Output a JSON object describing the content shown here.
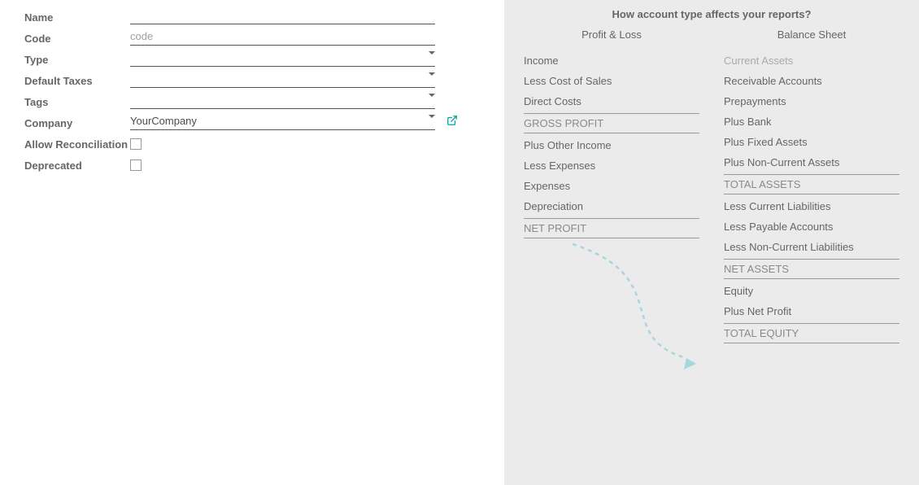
{
  "labels": {
    "name": "Name",
    "code": "Code",
    "type": "Type",
    "default_taxes": "Default Taxes",
    "tags": "Tags",
    "company": "Company",
    "allow_reconciliation": "Allow Reconciliation",
    "deprecated": "Deprecated"
  },
  "placeholders": {
    "code": "code"
  },
  "values": {
    "name": "",
    "type": "",
    "default_taxes": "",
    "tags": "",
    "company": "YourCompany"
  },
  "info": {
    "heading": "How account type affects your reports?",
    "pl_title": "Profit & Loss",
    "bs_title": "Balance Sheet",
    "pl": {
      "income": "Income",
      "less_cos": "Less Cost of Sales",
      "direct_costs": "Direct Costs",
      "gross_profit": "GROSS PROFIT",
      "plus_other_income": "Plus Other Income",
      "less_expenses": "Less Expenses",
      "expenses": "Expenses",
      "depreciation": "Depreciation",
      "net_profit": "NET PROFIT"
    },
    "bs": {
      "current_assets": "Current Assets",
      "receivable_accounts": "Receivable Accounts",
      "prepayments": "Prepayments",
      "plus_bank": "Plus Bank",
      "plus_fixed_assets": "Plus Fixed Assets",
      "plus_noncurrent_assets": "Plus Non-Current Assets",
      "total_assets": "TOTAL ASSETS",
      "less_current_liabilities": "Less Current Liabilities",
      "less_payable_accounts": "Less Payable Accounts",
      "less_noncurrent_liabilities": "Less Non-Current Liabilities",
      "net_assets": "NET ASSETS",
      "equity": "Equity",
      "plus_net_profit": "Plus Net Profit",
      "total_equity": "TOTAL EQUITY"
    }
  }
}
